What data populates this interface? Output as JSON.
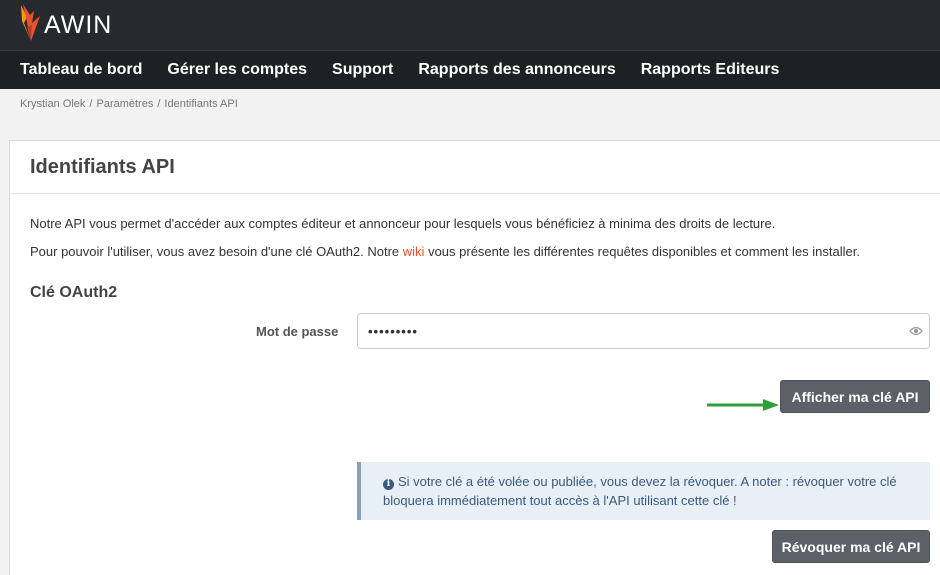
{
  "brand": {
    "name": "AWIN",
    "icon": "awin-flame-logo",
    "accent": "#e8522c"
  },
  "nav": {
    "items": [
      {
        "label": "Tableau de bord"
      },
      {
        "label": "Gérer les comptes"
      },
      {
        "label": "Support"
      },
      {
        "label": "Rapports des annonceurs"
      },
      {
        "label": "Rapports Editeurs"
      }
    ]
  },
  "breadcrumb": {
    "items": [
      "Krystian Olek",
      "Paramètres",
      "Identifiants API"
    ],
    "separator": "/"
  },
  "panel": {
    "title": "Identifiants API",
    "desc1": "Notre API vous permet d'accéder aux comptes éditeur et annonceur pour lesquels vous bénéficiez à minima des droits de lecture.",
    "desc2_before": "Pour pouvoir l'utiliser, vous avez besoin d'une clé OAuth2. Notre ",
    "desc2_link": "wiki",
    "desc2_after": " vous présente les différentes requêtes disponibles et comment les installer.",
    "section_title": "Clé OAuth2",
    "password_label": "Mot de passe",
    "password_value": "•••••••••",
    "show_button": "Afficher ma clé API",
    "alert_text": "Si votre clé a été volée ou publiée, vous devez la révoquer. A noter : révoquer votre clé bloquera immédiatement tout accès à l'API utilisant cette clé !",
    "revoke_button": "Révoquer ma clé API"
  },
  "colors": {
    "topbar": "#26292d",
    "button": "#5d6066",
    "alert_bg": "#e8eff6",
    "arrow": "#2e9e3a"
  }
}
